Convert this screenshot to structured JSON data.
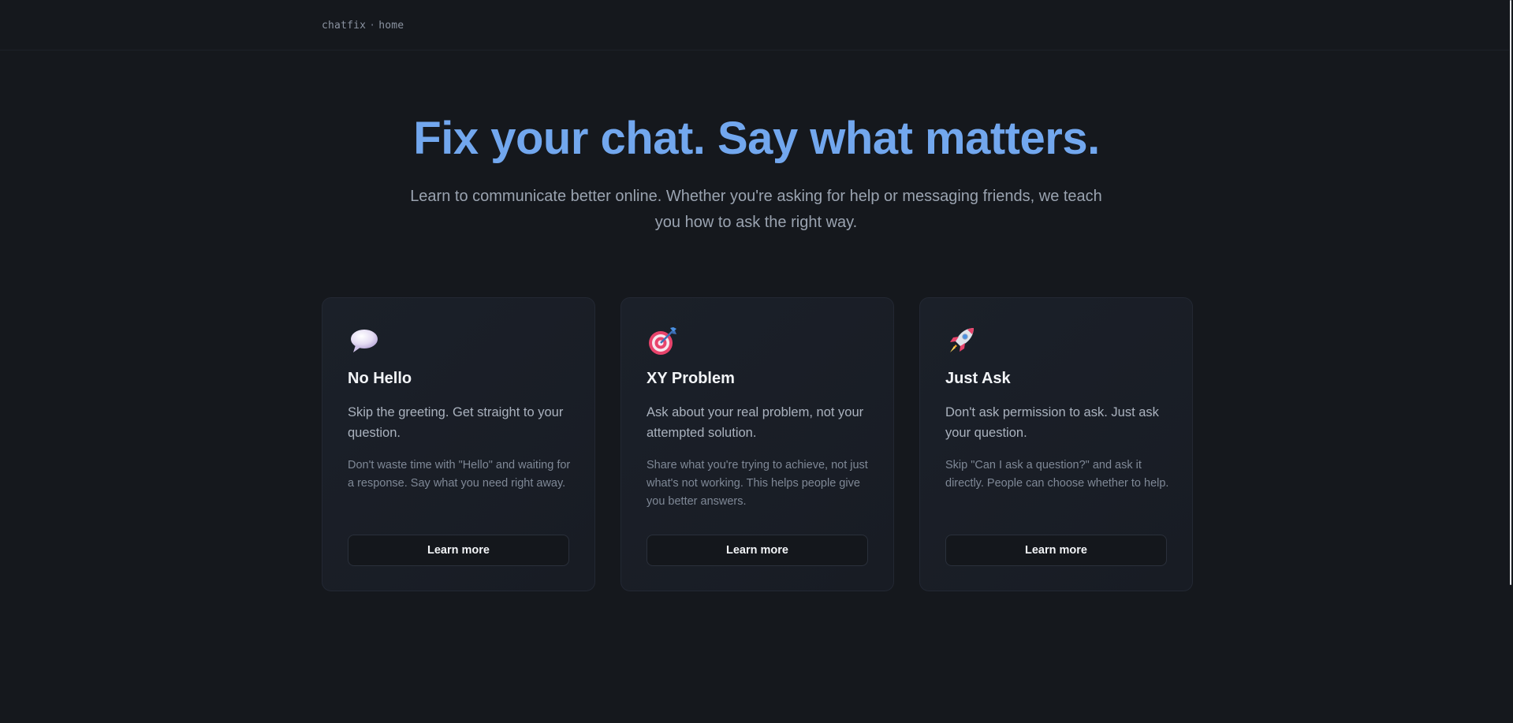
{
  "breadcrumb": {
    "site": "chatfix",
    "separator": "·",
    "page": "home"
  },
  "hero": {
    "title": "Fix your chat. Say what matters.",
    "subtitle": "Learn to communicate better online. Whether you're asking for help or messaging friends, we teach you how to ask the right way."
  },
  "cards": [
    {
      "icon": "speech-bubble-icon",
      "title": "No Hello",
      "lead": "Skip the greeting. Get straight to your question.",
      "description": "Don't waste time with \"Hello\" and waiting for a response. Say what you need right away.",
      "button": "Learn more"
    },
    {
      "icon": "target-icon",
      "title": "XY Problem",
      "lead": "Ask about your real problem, not your attempted solution.",
      "description": "Share what you're trying to achieve, not just what's not working. This helps people give you better answers.",
      "button": "Learn more"
    },
    {
      "icon": "rocket-icon",
      "title": "Just Ask",
      "lead": "Don't ask permission to ask. Just ask your question.",
      "description": "Skip \"Can I ask a question?\" and ask it directly. People can choose whether to help.",
      "button": "Learn more"
    }
  ],
  "colors": {
    "background": "#15181d",
    "accent": "#72a7ee",
    "card_border": "#232833"
  }
}
